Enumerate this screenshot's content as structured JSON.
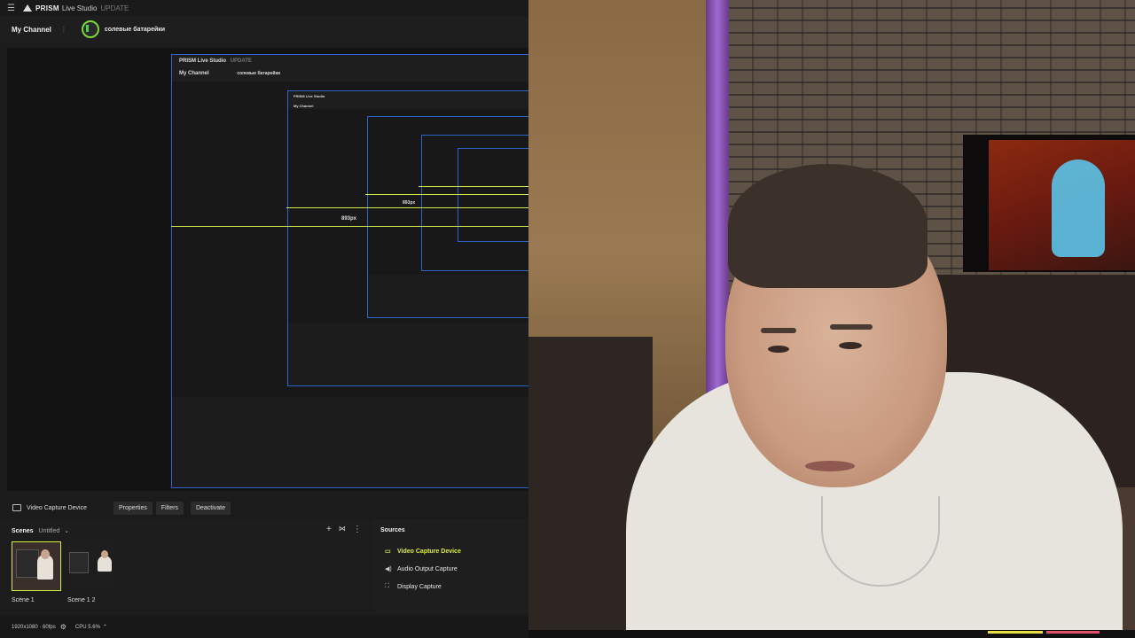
{
  "app": {
    "brand": "PRISM",
    "brand_sub": "Live Studio",
    "update_label": "UPDATE",
    "channel_title": "My Channel",
    "channel_name": "солевые батарейки"
  },
  "preview": {
    "guide_label": "893px",
    "nested_channel_title": "My Channel",
    "nested_channel_name": "солевые батарейки",
    "nested_brand": "PRISM Live Studio",
    "nested_update": "UPDATE"
  },
  "toolbar": {
    "device_name": "Video Capture Device",
    "properties_label": "Properties",
    "filters_label": "Filters",
    "deactivate_label": "Deactivate"
  },
  "scenes": {
    "title": "Scenes",
    "collection": "Untitled",
    "items": [
      {
        "label": "Scene 1",
        "selected": true
      },
      {
        "label": "Scene 1 2",
        "selected": false
      }
    ]
  },
  "sources": {
    "title": "Sources",
    "items": [
      {
        "label": "Video Capture Device",
        "icon": "camera-icon",
        "active": true
      },
      {
        "label": "Audio Output Capture",
        "icon": "speaker-icon",
        "active": false
      },
      {
        "label": "Display Capture",
        "icon": "display-icon",
        "active": false
      }
    ]
  },
  "status": {
    "resolution": "1920x1080 · 60fps",
    "cpu": "CPU 5.6%"
  },
  "colors": {
    "accent": "#d9ee3c",
    "selection_border": "#2f63c9",
    "channel_ring": "#7ad83a"
  }
}
